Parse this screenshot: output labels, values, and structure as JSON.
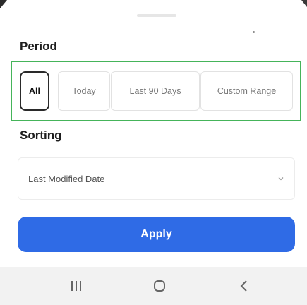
{
  "period": {
    "title": "Period",
    "options": [
      "All",
      "Today",
      "Last 90 Days",
      "Custom Range"
    ],
    "selected": "All"
  },
  "sorting": {
    "title": "Sorting",
    "selected": "Last Modified Date"
  },
  "apply_label": "Apply",
  "navigation": {
    "icons": [
      "recent-apps-icon",
      "home-icon",
      "back-icon"
    ]
  },
  "colors": {
    "accent": "#2f6be6",
    "highlight_border": "#45b45a",
    "selected_border": "#2a2a2a",
    "nav_background": "#f2f2f2"
  }
}
